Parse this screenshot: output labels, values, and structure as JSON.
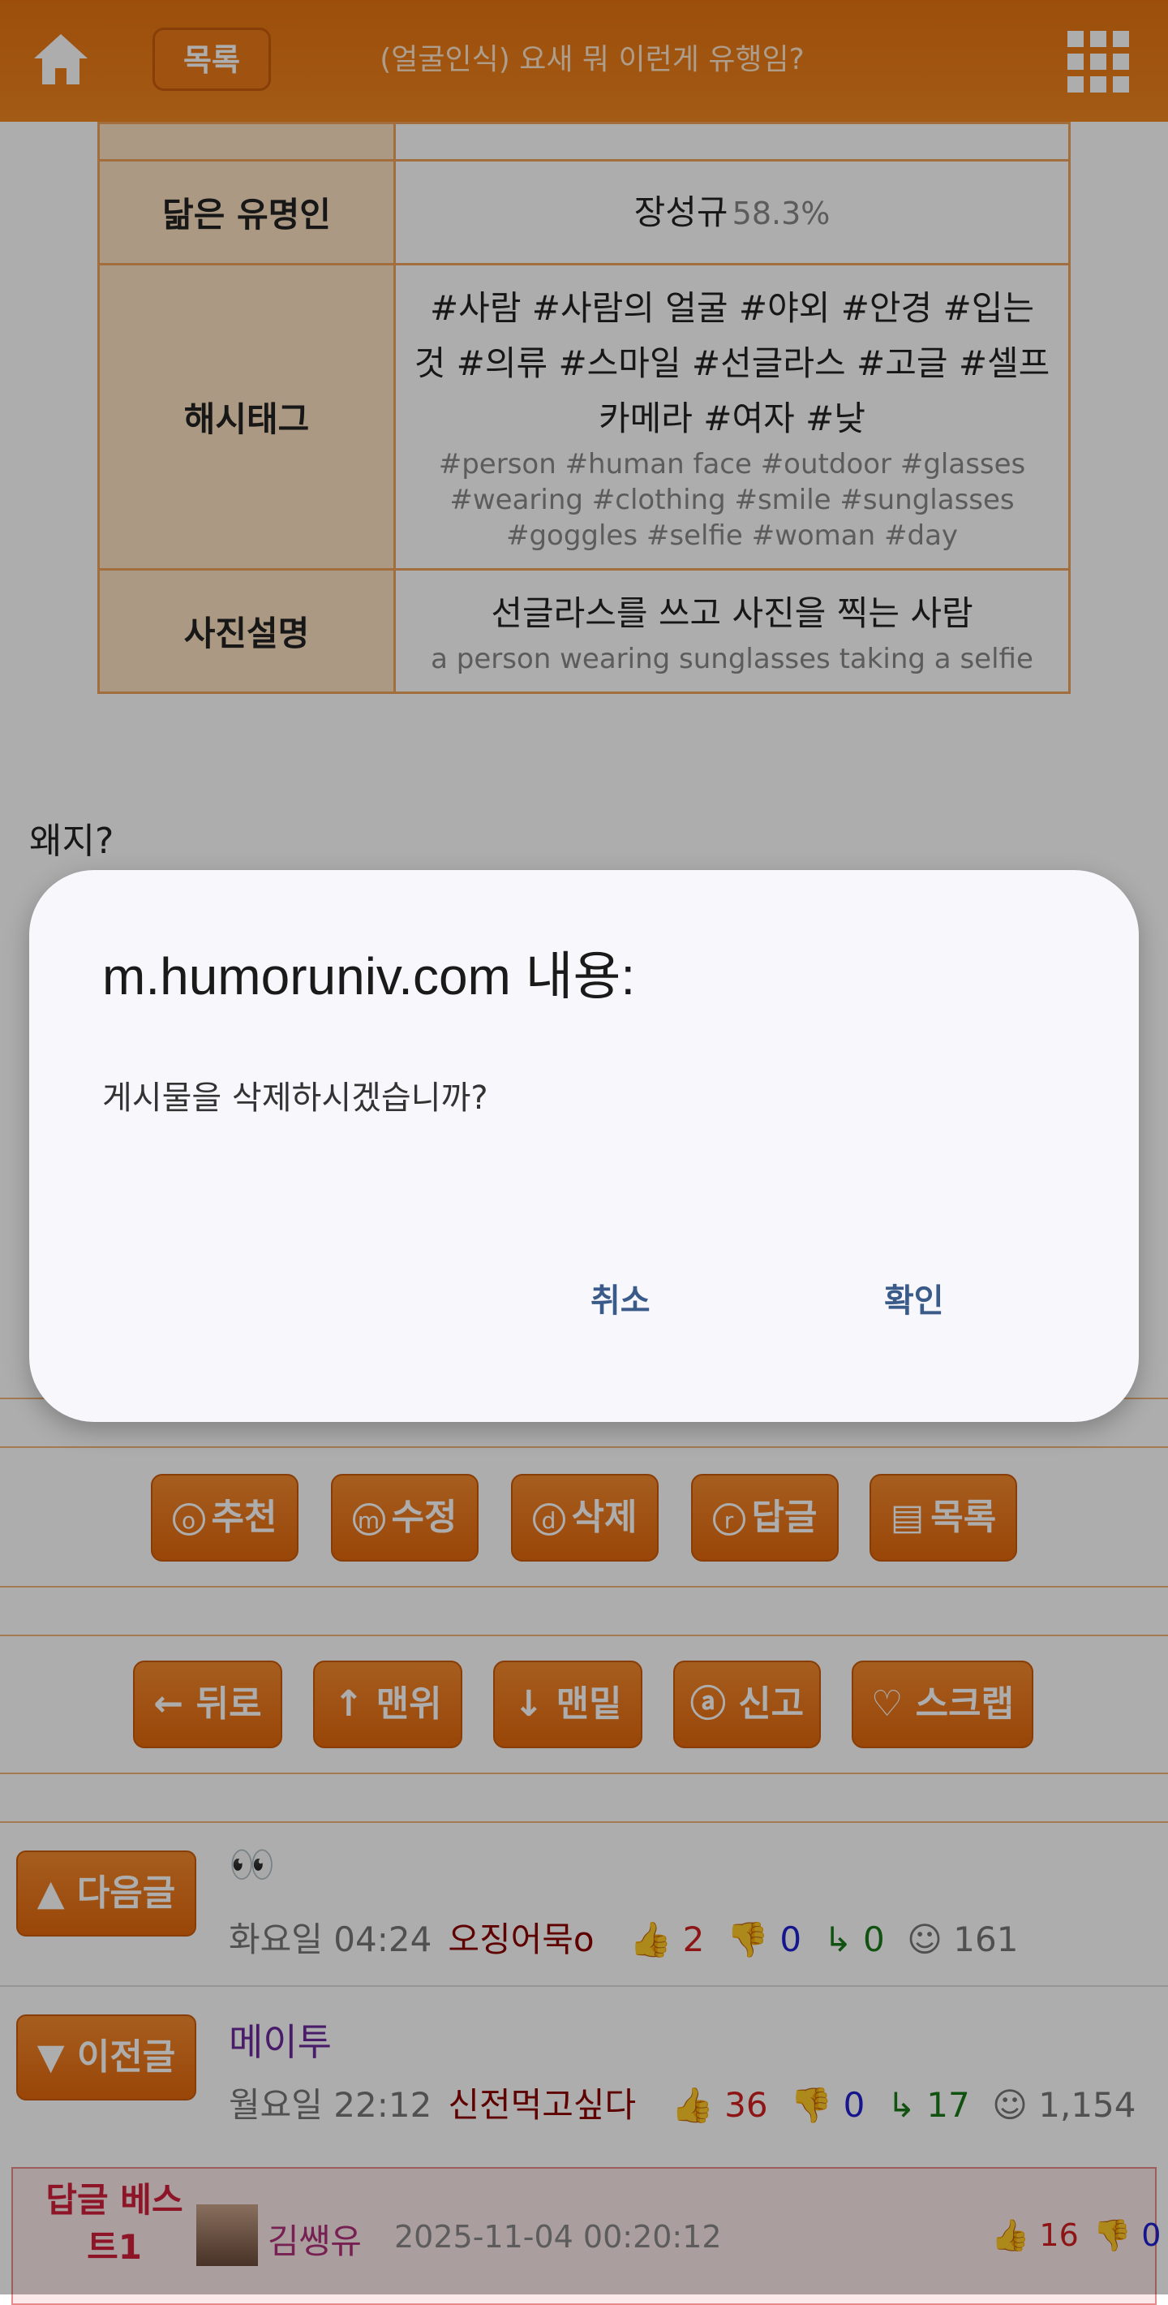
{
  "topbar": {
    "list_label": "목록",
    "title": "(얼굴인식) 요새 뭐 이런게 유행임?"
  },
  "info_table": {
    "celebrity_label": "닮은 유명인",
    "celebrity_name": "장성규",
    "celebrity_percent": "58.3%",
    "hashtag_label": "해시태그",
    "hashtags_ko": "#사람 #사람의 얼굴 #야외 #안경 #입는 것 #의류 #스마일 #선글라스 #고글 #셀프카메라 #여자 #낮",
    "hashtags_en": "#person #human face #outdoor #glasses #wearing #clothing #smile #sunglasses #goggles #selfie #woman #day",
    "desc_label": "사진설명",
    "desc_ko": "선글라스를 쓰고 사진을 찍는 사람",
    "desc_en": "a person wearing sunglasses taking a selfie"
  },
  "body": {
    "text": "왜지?"
  },
  "action_buttons": [
    {
      "key": "o",
      "label": "추천"
    },
    {
      "key": "m",
      "label": "수정"
    },
    {
      "key": "d",
      "label": "삭제"
    },
    {
      "key": "r",
      "label": "답글"
    },
    {
      "key": "▤",
      "label": "목록"
    }
  ],
  "nav_buttons": [
    {
      "label": "← 뒤로"
    },
    {
      "label": "↑ 맨위"
    },
    {
      "label": "↓ 맨밑"
    },
    {
      "label": "ⓐ 신고"
    },
    {
      "label": "♡ 스크랩"
    }
  ],
  "next_post": {
    "button": "▲ 다음글",
    "title": "👀",
    "time": "화요일 04:24",
    "author": "오징어묵o",
    "up": "2",
    "down": "0",
    "replies": "0",
    "views": "161"
  },
  "prev_post": {
    "button": "▼ 이전글",
    "title": "메이투",
    "time": "월요일 22:12",
    "author": "신전먹고싶다",
    "up": "36",
    "down": "0",
    "replies": "17",
    "views": "1,154"
  },
  "best_reply": {
    "label": "답글 베스트1",
    "name": "김쌩유",
    "date": "2025-11-04 00:20:12",
    "up": "16",
    "down": "0"
  },
  "dialog": {
    "title": "m.humoruniv.com 내용:",
    "message": "게시물을 삭제하시겠습니까?",
    "cancel": "취소",
    "confirm": "확인"
  }
}
